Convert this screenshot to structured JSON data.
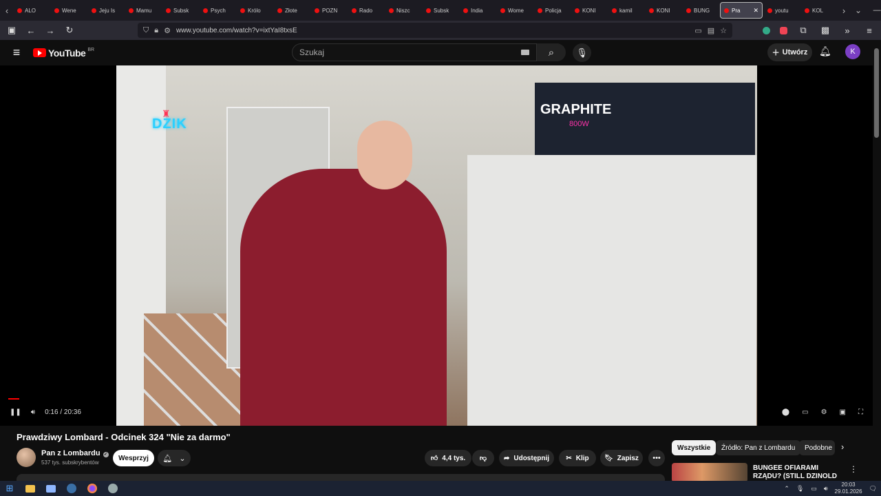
{
  "browser": {
    "tabs": [
      {
        "label": "ALO"
      },
      {
        "label": "Wene"
      },
      {
        "label": "Jeju Is"
      },
      {
        "label": "Mamu"
      },
      {
        "label": "Subsk"
      },
      {
        "label": "Psych"
      },
      {
        "label": "Królo"
      },
      {
        "label": "Złote"
      },
      {
        "label": "POZN"
      },
      {
        "label": "Rado"
      },
      {
        "label": "Niszc"
      },
      {
        "label": "Subsk"
      },
      {
        "label": "India"
      },
      {
        "label": "Wome"
      },
      {
        "label": "Policja"
      },
      {
        "label": "KONI"
      },
      {
        "label": "kamil"
      },
      {
        "label": "KONI"
      },
      {
        "label": "BUNG"
      },
      {
        "label": "Pra"
      },
      {
        "label": "youtu"
      },
      {
        "label": "KOL"
      }
    ],
    "url": "www.youtube.com/watch?v=ixtYaI8txsE"
  },
  "youtube": {
    "logo_text": "YouTube",
    "logo_region": "BR",
    "search_placeholder": "Szukaj",
    "create_label": "Utwórz",
    "avatar_letter": "K"
  },
  "player": {
    "time": "0:16 / 20:36",
    "progress": 0.013,
    "overlay": {
      "neon": "DZIK",
      "brand": "GRAPHITE",
      "power": "800W"
    }
  },
  "video": {
    "title": "Prawdziwy Lombard - Odcinek 324 \"Nie za darmo\"",
    "channel": "Pan z Lombardu",
    "subscribers": "537 tys. subskrybentów",
    "support_label": "Wesprzyj",
    "likes": "4,4 tys.",
    "share_label": "Udostępnij",
    "clip_label": "Klip",
    "save_label": "Zapisz"
  },
  "sidebar": {
    "chips": [
      {
        "label": "Wszystkie",
        "active": true
      },
      {
        "label": "Źródło: Pan z Lombardu"
      },
      {
        "label": "Podobne"
      }
    ],
    "rec_title": "BUNGEE OFIARAMI RZĄDU? (STILL DZINOLD BANDURA"
  },
  "taskbar": {
    "time": "20:03",
    "date": "29.01.2026"
  },
  "colors": {
    "accent": "#ff0000",
    "background": "#0f0f0f",
    "avatar": "#7b3fc4"
  }
}
